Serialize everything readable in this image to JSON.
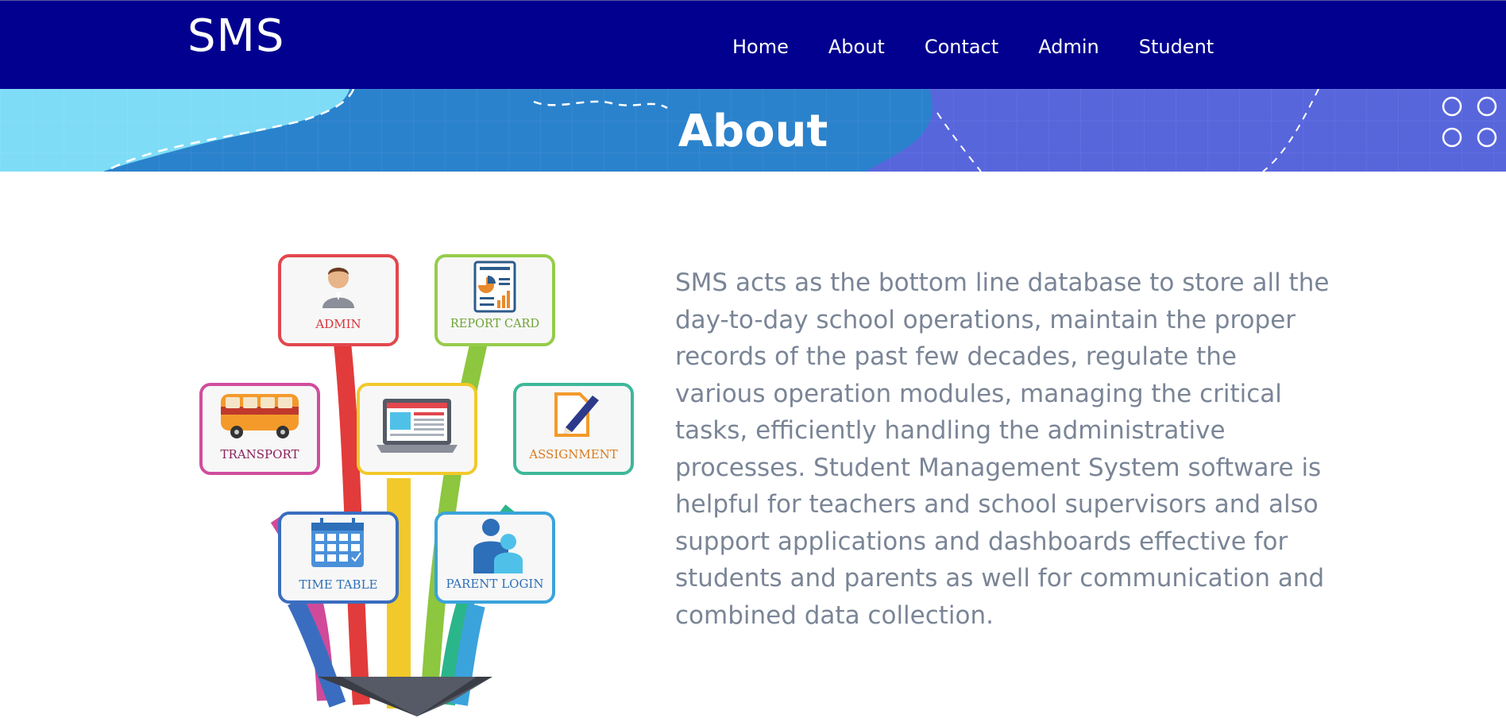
{
  "brand": "SMS",
  "nav": {
    "home": "Home",
    "about": "About",
    "contact": "Contact",
    "admin": "Admin",
    "student": "Student"
  },
  "banner": {
    "title": "About"
  },
  "modules": {
    "admin": "ADMIN",
    "report_card": "REPORT CARD",
    "transport": "TRANSPORT",
    "assignment": "ASSIGNMENT",
    "time_table": "TIME TABLE",
    "parent_login": "PARENT LOGIN"
  },
  "about": {
    "description": "SMS acts as the bottom line database to store all the day-to-day school operations, maintain the proper records of the past few decades, regulate the various operation modules, managing the critical tasks, efficiently handling the administrative processes. Student Management System software is helpful for teachers and school supervisors and also support applications and dashboards effective for students and parents as well for communication and combined data collection."
  },
  "colors": {
    "navbar": "#02008f",
    "banner_left": "#7fdcf7",
    "banner_mid": "#2b82cc",
    "banner_right": "#5866dc",
    "body_text": "#7a8596"
  }
}
